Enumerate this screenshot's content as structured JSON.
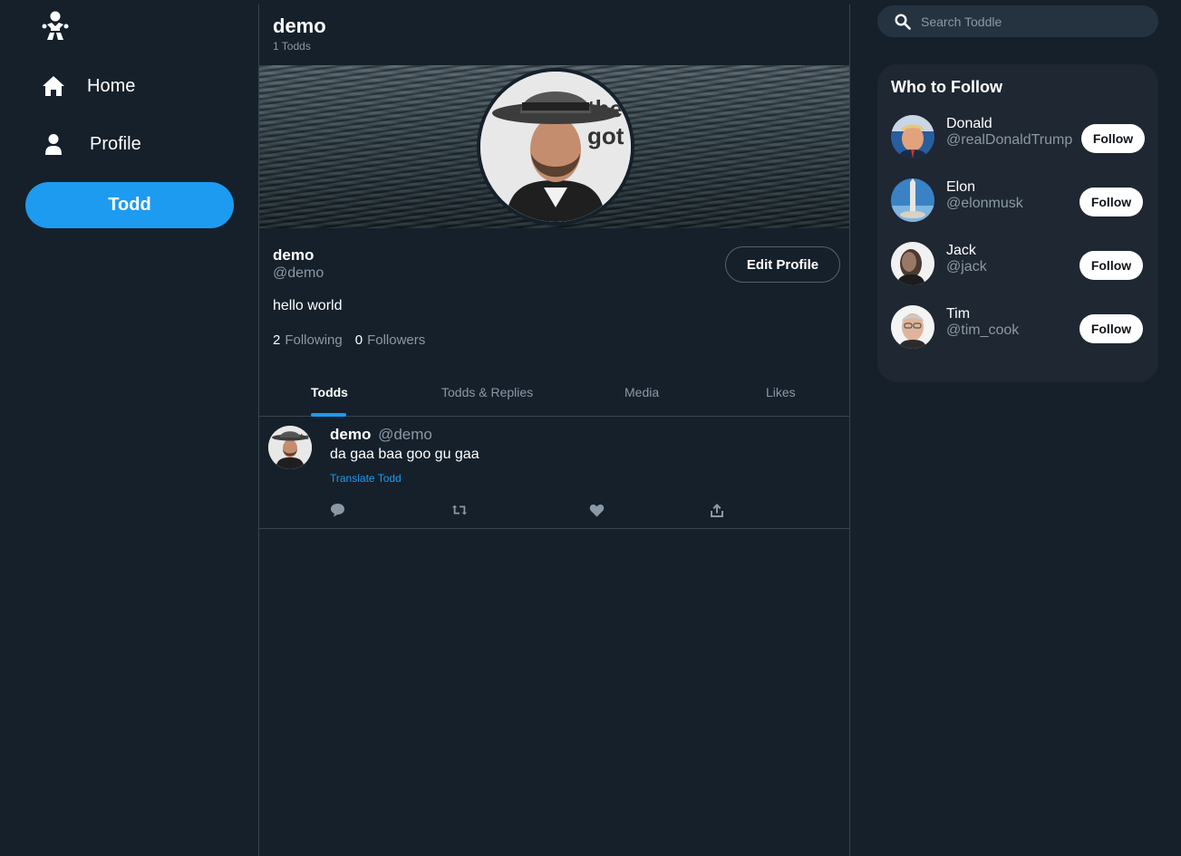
{
  "nav": {
    "home_label": "Home",
    "profile_label": "Profile",
    "todd_button": "Todd"
  },
  "header": {
    "title": "demo",
    "subtitle": "1 Todds"
  },
  "profile": {
    "name": "demo",
    "handle": "@demo",
    "edit_button": "Edit Profile",
    "bio": "hello world",
    "following_count": "2",
    "following_label": "Following",
    "followers_count": "0",
    "followers_label": "Followers"
  },
  "tabs": [
    {
      "label": "Todds",
      "active": true
    },
    {
      "label": "Todds & Replies",
      "active": false
    },
    {
      "label": "Media",
      "active": false
    },
    {
      "label": "Likes",
      "active": false
    }
  ],
  "todds": [
    {
      "name": "demo",
      "handle": "@demo",
      "text": "da gaa baa goo gu gaa",
      "translate_label": "Translate Todd",
      "actions": [
        "comment-icon",
        "retodd-icon",
        "heart-icon",
        "share-icon"
      ]
    }
  ],
  "search": {
    "placeholder": "Search Toddle"
  },
  "who_to_follow": {
    "title": "Who to Follow",
    "users": [
      {
        "name": "Donald",
        "handle": "@realDonaldTrump",
        "button": "Follow"
      },
      {
        "name": "Elon",
        "handle": "@elonmusk",
        "button": "Follow"
      },
      {
        "name": "Jack",
        "handle": "@jack",
        "button": "Follow"
      },
      {
        "name": "Tim",
        "handle": "@tim_cook",
        "button": "Follow"
      }
    ]
  },
  "colors": {
    "background": "#15202b",
    "accent": "#1d9bf0",
    "muted_text": "#8b98a5",
    "border": "#38444d",
    "panel": "#1e2732"
  }
}
